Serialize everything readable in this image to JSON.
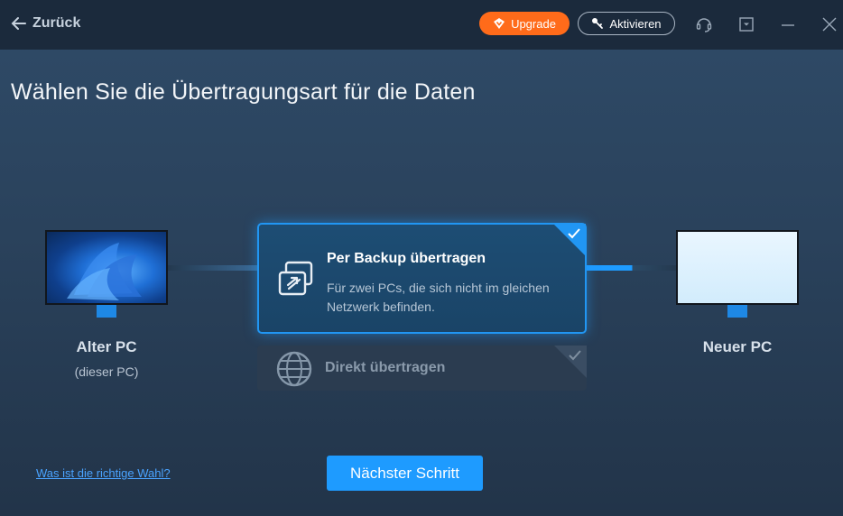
{
  "titlebar": {
    "back_label": "Zurück",
    "upgrade_label": "Upgrade",
    "activate_label": "Aktivieren"
  },
  "heading": "Wählen Sie die Übertragungsart für die Daten",
  "old_pc": {
    "title": "Alter PC",
    "subtitle": "(dieser PC)"
  },
  "new_pc": {
    "title": "Neuer PC"
  },
  "options": [
    {
      "title": "Per Backup übertragen",
      "desc_line1": "Für zwei PCs, die sich nicht im gleichen",
      "desc_line2": "Netzwerk befinden.",
      "selected": true
    },
    {
      "title": "Direkt übertragen",
      "selected": false
    }
  ],
  "help_link": "Was ist die richtige Wahl?",
  "next_button": "Nächster Schritt",
  "colors": {
    "accent": "#1e9bff",
    "upgrade": "#ff6b1a",
    "titlebar": "#1b2a3c",
    "link": "#4aa3ff"
  }
}
